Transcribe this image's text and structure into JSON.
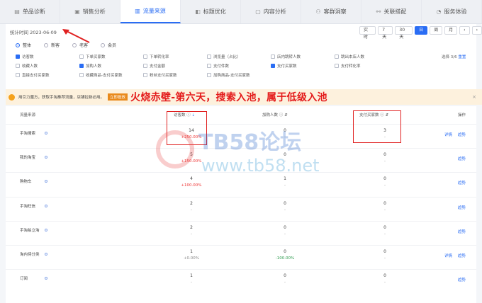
{
  "tabs": [
    {
      "label": "单品诊断",
      "icon": "doc-icon"
    },
    {
      "label": "销售分析",
      "icon": "bag-icon"
    },
    {
      "label": "流量来源",
      "icon": "chart-icon",
      "active": true
    },
    {
      "label": "标题优化",
      "icon": "tag-icon"
    },
    {
      "label": "内容分析",
      "icon": "content-icon"
    },
    {
      "label": "客群洞察",
      "icon": "people-icon"
    },
    {
      "label": "关联搭配",
      "icon": "link-icon"
    },
    {
      "label": "服务体验",
      "icon": "service-icon"
    }
  ],
  "stat_time": "统计时间 2023-06-09",
  "range_buttons": [
    "实时",
    "7天",
    "30天",
    "日",
    "周",
    "月"
  ],
  "range_active": "日",
  "nav": {
    "prev": "‹",
    "next": "›"
  },
  "audience": [
    "整体",
    "新客",
    "老客",
    "会员"
  ],
  "metrics": [
    {
      "label": "访客数",
      "on": true
    },
    {
      "label": "下单买家数",
      "on": false
    },
    {
      "label": "下单转化率",
      "on": false
    },
    {
      "label": "浏览量（占比）",
      "on": false
    },
    {
      "label": "店内跳转人数",
      "on": false
    },
    {
      "label": "跳出本店人数",
      "on": false
    },
    {
      "label": "收藏人数",
      "on": false
    },
    {
      "label": "加购人数",
      "on": true
    },
    {
      "label": "支付金额",
      "on": false
    },
    {
      "label": "支付件数",
      "on": false
    },
    {
      "label": "支付买家数",
      "on": true
    },
    {
      "label": "支付转化率",
      "on": false
    },
    {
      "label": "直接支付买家数",
      "on": false
    },
    {
      "label": "收藏商品-支付买家数",
      "on": false
    },
    {
      "label": "粉丝支付买家数",
      "on": false
    },
    {
      "label": "加购商品-支付买家数",
      "on": false
    }
  ],
  "choose_text": "选择 3/6",
  "reset_text": "重置",
  "notice": {
    "text": "用引力魔方，获取手淘推荐流量，店铺拉新必用。",
    "tag": "立即投放",
    "headline": "火烧赤壁-第六天，搜索入池，属于低级入池",
    "close": "×"
  },
  "table": {
    "headers": {
      "source": "流量来源",
      "visitors": "访客数",
      "cart": "加购人数",
      "buyers": "支付买家数",
      "ops": "操作"
    },
    "rows": [
      {
        "name": "手淘搜索",
        "v": "14",
        "vs": "+250.00%",
        "vs_class": "up",
        "c": "0",
        "cs": "-",
        "b": "3",
        "bs": "-",
        "ops": [
          "详情",
          "趋势"
        ]
      },
      {
        "name": "我的淘宝",
        "v": "5",
        "vs": "+150.00%",
        "vs_class": "up",
        "c": "0",
        "cs": "-",
        "b": "0",
        "bs": "-",
        "ops": [
          "趋势"
        ]
      },
      {
        "name": "购物车",
        "v": "4",
        "vs": "+100.00%",
        "vs_class": "up",
        "c": "1",
        "cs": "-",
        "b": "0",
        "bs": "-",
        "ops": [
          "趋势"
        ]
      },
      {
        "name": "手淘旺信",
        "v": "2",
        "vs": "-",
        "vs_class": "dash",
        "c": "0",
        "cs": "-",
        "b": "0",
        "bs": "-",
        "ops": [
          "趋势"
        ]
      },
      {
        "name": "手淘拍立淘",
        "v": "2",
        "vs": "-",
        "vs_class": "dash",
        "c": "0",
        "cs": "-",
        "b": "0",
        "bs": "-",
        "ops": [
          "趋势"
        ]
      },
      {
        "name": "淘内待分类",
        "v": "1",
        "vs": "+0.00%",
        "vs_class": "dash",
        "c": "0",
        "cs": "-100.00%",
        "b": "0",
        "bs": "-",
        "ops": [
          "详情",
          "趋势"
        ]
      },
      {
        "name": "订阅",
        "v": "1",
        "vs": "-",
        "vs_class": "dash",
        "c": "0",
        "cs": "-",
        "b": "0",
        "bs": "-",
        "ops": [
          "趋势"
        ]
      }
    ]
  },
  "watermark": {
    "line1": "TB58论坛",
    "line2": "www.tb58.net"
  }
}
